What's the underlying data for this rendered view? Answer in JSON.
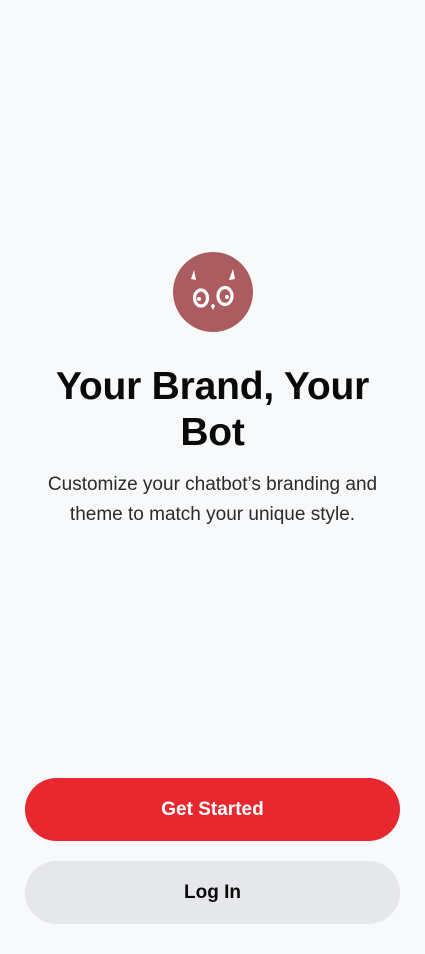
{
  "onboarding": {
    "logo_icon": "owl-face-icon",
    "logo_color": "#ab5c60",
    "title": "Your Brand, Your Bot",
    "subtitle": "Customize your chatbot’s branding and theme to match your unique style."
  },
  "actions": {
    "primary_label": "Get Started",
    "primary_color": "#e8282f",
    "secondary_label": "Log In",
    "secondary_color": "#e6e7ea"
  }
}
